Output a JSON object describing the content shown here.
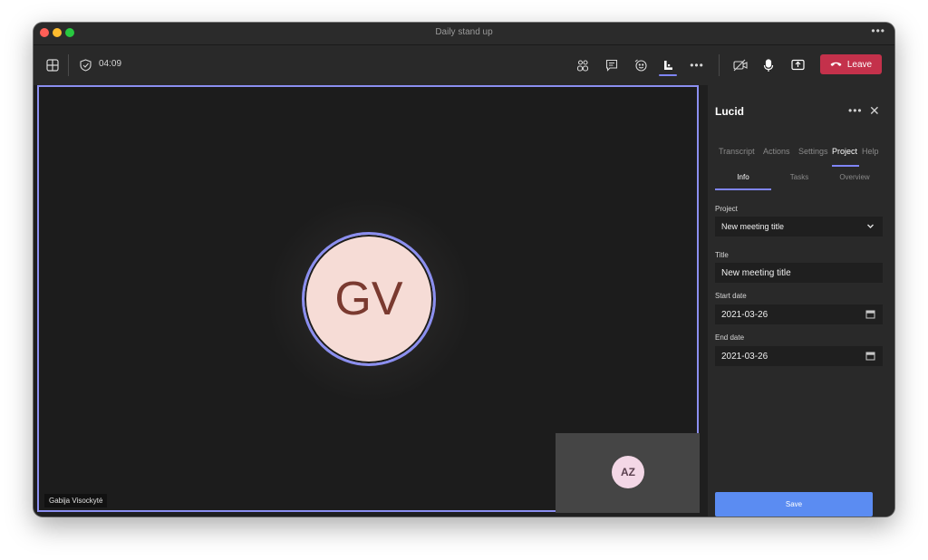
{
  "window": {
    "title": "Daily stand up"
  },
  "toolbar": {
    "timer": "04:09",
    "leave_label": "Leave"
  },
  "stage": {
    "main_participant": {
      "initials": "GV",
      "name": "Gabija Visockytė"
    },
    "pip_participant": {
      "initials": "AZ"
    }
  },
  "panel": {
    "title": "Lucid",
    "tabs": [
      "Transcript",
      "Actions",
      "Settings",
      "Project",
      "Help"
    ],
    "active_tab": "Project",
    "subtabs": [
      "Info",
      "Tasks",
      "Overview"
    ],
    "active_subtab": "Info",
    "fields": {
      "project": {
        "label": "Project",
        "value": "New meeting title"
      },
      "title": {
        "label": "Title",
        "value": "New meeting title"
      },
      "start_date": {
        "label": "Start date",
        "value": "2021-03-26"
      },
      "end_date": {
        "label": "End date",
        "value": "2021-03-26"
      }
    },
    "save_label": "Save"
  },
  "colors": {
    "accent": "#7f85f5",
    "leave": "#c4314b",
    "save": "#5b8cf2",
    "avatar_main_bg": "#f6dcd6",
    "avatar_pip_bg": "#f3d7e6"
  }
}
